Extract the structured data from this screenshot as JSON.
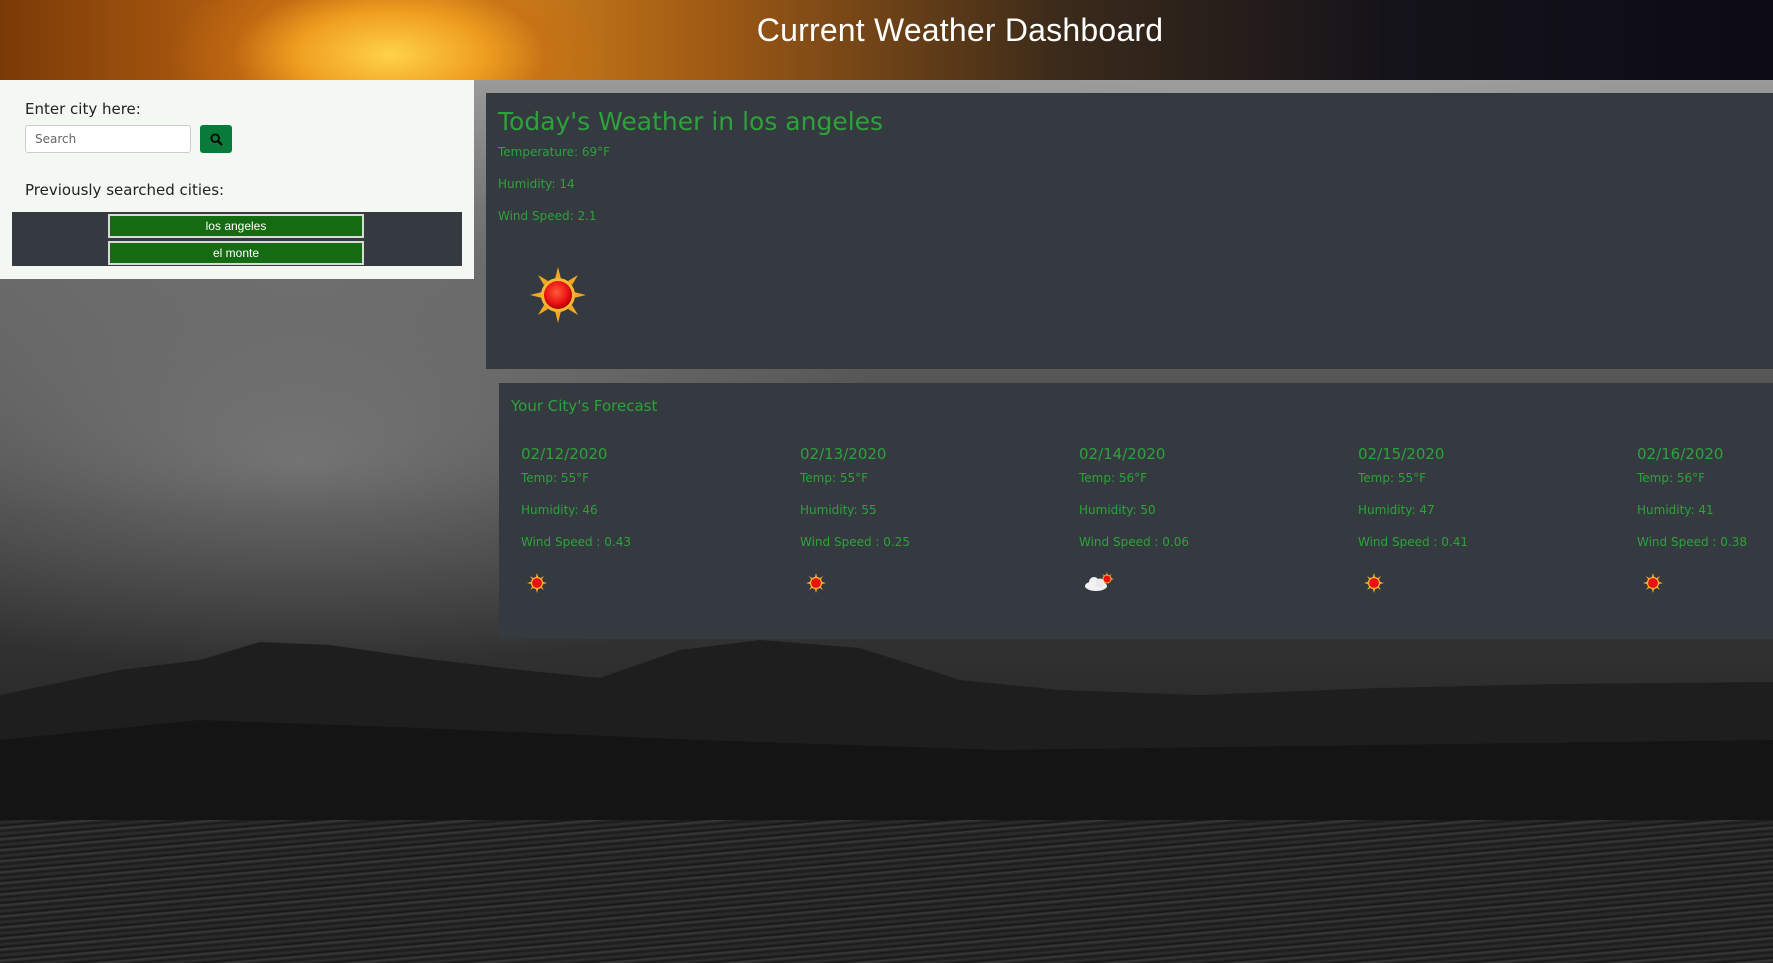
{
  "header": {
    "title": "Current Weather Dashboard"
  },
  "search": {
    "label": "Enter city here:",
    "placeholder": "Search",
    "button_icon": "search-icon"
  },
  "history": {
    "label": "Previously searched cities:",
    "cities": [
      "los angeles",
      "el monte"
    ]
  },
  "today": {
    "title": "Today's Weather in los angeles",
    "temperature": "Temperature: 69°F",
    "humidity": "Humidity: 14",
    "wind": "Wind Speed: 2.1",
    "icon": "sun-icon"
  },
  "forecast": {
    "title": "Your City's Forecast",
    "days": [
      {
        "date": "02/12/2020",
        "temp": "Temp: 55°F",
        "humidity": "Humidity: 46",
        "wind": "Wind Speed : 0.43",
        "icon": "sun-icon"
      },
      {
        "date": "02/13/2020",
        "temp": "Temp: 55°F",
        "humidity": "Humidity: 55",
        "wind": "Wind Speed : 0.25",
        "icon": "sun-icon"
      },
      {
        "date": "02/14/2020",
        "temp": "Temp: 56°F",
        "humidity": "Humidity: 50",
        "wind": "Wind Speed : 0.06",
        "icon": "partly-cloudy-icon"
      },
      {
        "date": "02/15/2020",
        "temp": "Temp: 55°F",
        "humidity": "Humidity: 47",
        "wind": "Wind Speed : 0.41",
        "icon": "sun-icon"
      },
      {
        "date": "02/16/2020",
        "temp": "Temp: 56°F",
        "humidity": "Humidity: 41",
        "wind": "Wind Speed : 0.38",
        "icon": "sun-icon"
      }
    ]
  },
  "colors": {
    "accent_green": "#2da23a",
    "card_bg": "#343a40",
    "button_green": "#156b12"
  }
}
